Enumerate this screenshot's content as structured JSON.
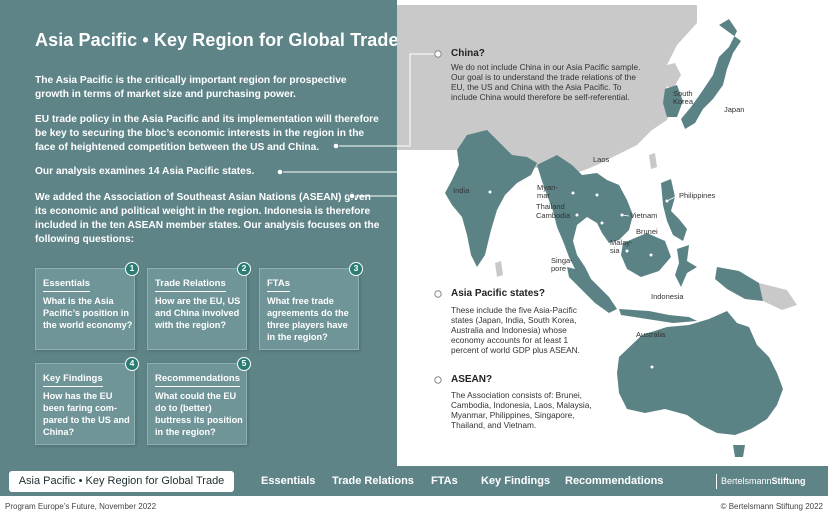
{
  "title": "Asia Pacific • Key Region for Global Trade",
  "intro": [
    "The Asia Pacific is the critically important region for prospective growth in terms of market size and purchasing power.",
    "EU trade policy in the Asia Pacific and its implementation will therefore be key to securing the bloc’s economic interests in the region in the face of heightened competition between the US and China.",
    "Our analysis examines 14 Asia Pacific states.",
    "We added the Association of Southeast Asian Nations (ASEAN) given its economic and political weight in the region. Indonesia is therefore included in the ten ASEAN member states. Our analysis focuses on the following questions:"
  ],
  "cards": [
    {
      "num": "1",
      "title": "Essentials",
      "question": "What is the Asia Pacific’s position in the world economy?"
    },
    {
      "num": "2",
      "title": "Trade Relations",
      "question": "How are the EU, US and China involved with the region?"
    },
    {
      "num": "3",
      "title": "FTAs",
      "question": "What free trade agreements do the three players have in the region?"
    },
    {
      "num": "4",
      "title": "Key Findings",
      "question": "How has the EU been faring com-pared to the US and China?"
    },
    {
      "num": "5",
      "title": "Recommendations",
      "question": "What could the EU do to (better) buttress its position in the region?"
    }
  ],
  "callouts": {
    "china": {
      "title": "China?",
      "body": "We do not include China in our Asia Pacific sample. Our goal is to understand the trade relations of the EU, the US and China with the Asia Pacific. To include China would therefore be self-referential."
    },
    "asia_pacific": {
      "title": "Asia Pacific states?",
      "body": "These include the five Asia-Pacific states (Japan, India, South Korea, Australia and Indonesia) whose economy accounts for at least 1 percent of world GDP plus ASEAN."
    },
    "asean": {
      "title": "ASEAN?",
      "body": "The Association consists of: Brunei, Cambodia, Indonesia, Laos, Malaysia, Myanmar, Philippines, Singapore, Thailand, and Vietnam."
    }
  },
  "map_labels": {
    "south_korea": "South Korea",
    "japan": "Japan",
    "india": "India",
    "laos": "Laos",
    "myanmar": "Myan-mar",
    "thailand": "Thailand",
    "cambodia": "Cambodia",
    "vietnam": "Vietnam",
    "philippines": "Philippines",
    "brunei": "Brunei",
    "malaysia": "Malay-sia",
    "singapore": "Singa-pore",
    "indonesia": "Indonesia",
    "australia": "Australia"
  },
  "nav": {
    "active": "Asia Pacific • Key Region for Global Trade",
    "items": [
      "Essentials",
      "Trade Relations",
      "FTAs",
      "Key Findings",
      "Recommendations"
    ]
  },
  "brand": {
    "part1": "Bertelsmann",
    "part2": "Stiftung"
  },
  "footer": {
    "left": "Program Europe’s Future, November 2022",
    "right": "© Bertelsmann Stiftung 2022"
  },
  "colors": {
    "panel": "#5e8488",
    "card": "#6f9599",
    "country_highlight": "#5b8386",
    "country_other": "#c9c9c9",
    "badge": "#2b7d74"
  }
}
